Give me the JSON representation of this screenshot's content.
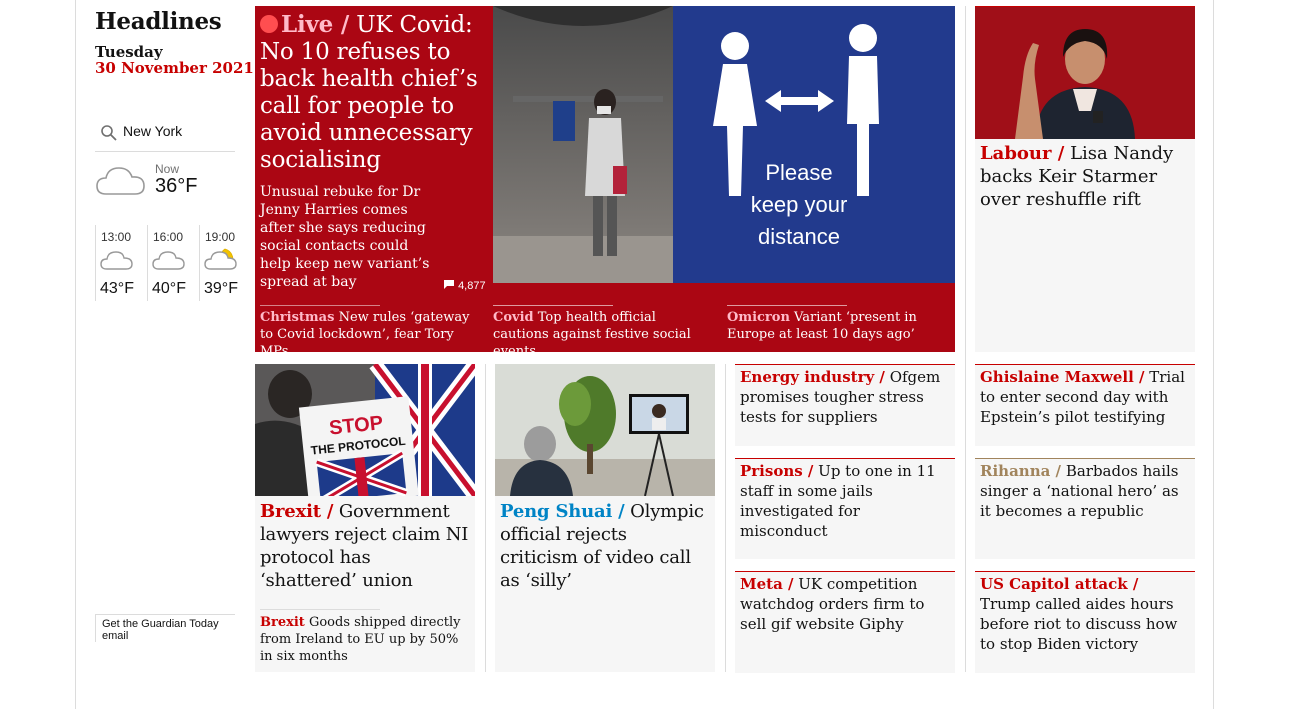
{
  "sidebar": {
    "title": "Headlines",
    "day": "Tuesday",
    "date": "30 November 2021",
    "location": "New York",
    "now_label": "Now",
    "now_temp": "36°F",
    "forecast": [
      {
        "time": "13:00",
        "temp": "43°F",
        "icon": "cloud-icon"
      },
      {
        "time": "16:00",
        "temp": "40°F",
        "icon": "cloud-icon"
      },
      {
        "time": "19:00",
        "temp": "39°F",
        "icon": "moon-cloud-icon"
      }
    ],
    "email_label": "Get the Guardian Today email"
  },
  "lead": {
    "live": "Live /",
    "headline": "UK Covid: No 10 refuses to back health chief’s call for people to avoid unnecessary socialising",
    "standfirst": "Unusual rebuke for Dr Jenny Harries comes after she says reducing social contacts could help keep new variant’s spread at bay",
    "comments": "4,877",
    "image_sign_line1": "Please",
    "image_sign_line2": "keep your",
    "image_sign_line3": "distance",
    "sublinks": [
      {
        "kicker": "Christmas",
        "text": "New rules ‘gateway to Covid lockdown’, fear Tory MPs"
      },
      {
        "kicker": "Covid",
        "text": "Top health official cautions against festive social events"
      },
      {
        "kicker": "Omicron",
        "text": "Variant ‘present in Europe at least 10 days ago’"
      }
    ]
  },
  "top_right": {
    "kicker": "Labour /",
    "headline": "Lisa Nandy backs Keir Starmer over reshuffle rift"
  },
  "brexit": {
    "kicker": "Brexit /",
    "headline": "Government lawyers reject claim NI protocol has ‘shattered’ union",
    "placard_line1": "STOP",
    "placard_line2": "THE PROTOCOL",
    "sublink_kicker": "Brexit",
    "sublink_text": "Goods shipped directly from Ireland to EU up by 50% in six months"
  },
  "peng": {
    "kicker": "Peng Shuai /",
    "headline": "Olympic official rejects criticism of video call as ‘silly’"
  },
  "small_cards": [
    {
      "kicker": "Energy industry /",
      "text": "Ofgem promises tougher stress tests for suppliers"
    },
    {
      "kicker": "Prisons /",
      "text": "Up to one in 11 staff in some jails investigated for misconduct"
    },
    {
      "kicker": "Meta /",
      "text": "UK competition watchdog orders firm to sell gif website Giphy"
    },
    {
      "kicker": "Ghislaine Maxwell /",
      "text": "Trial to enter second day with Epstein’s pilot testifying"
    },
    {
      "kicker": "Rihanna /",
      "text": "Barbados hails singer a ‘national hero’ as it becomes a republic"
    },
    {
      "kicker": "US Capitol attack /",
      "text": "Trump called aides hours before riot to discuss how to stop Biden victory"
    }
  ],
  "colors": {
    "news_red": "#c70000",
    "live_bg": "#ab0613",
    "sport_blue": "#0084c6",
    "culture_tan": "#a1845c"
  }
}
